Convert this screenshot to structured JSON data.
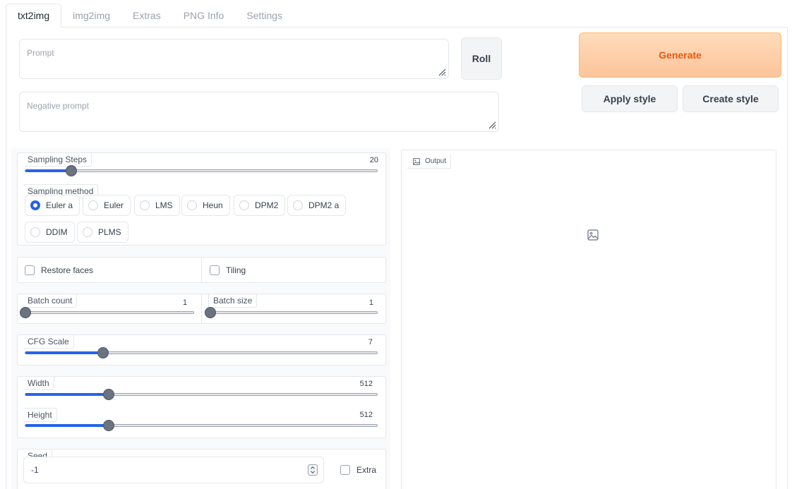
{
  "tabs": [
    {
      "label": "txt2img",
      "active": true
    },
    {
      "label": "img2img",
      "active": false
    },
    {
      "label": "Extras",
      "active": false
    },
    {
      "label": "PNG Info",
      "active": false
    },
    {
      "label": "Settings",
      "active": false
    }
  ],
  "prompt": {
    "placeholder": "Prompt",
    "value": ""
  },
  "negative_prompt": {
    "placeholder": "Negative prompt",
    "value": ""
  },
  "buttons": {
    "roll": "Roll",
    "generate": "Generate",
    "apply_style": "Apply style",
    "create_style": "Create style"
  },
  "sampling_steps": {
    "label": "Sampling Steps",
    "value": "20",
    "min": 1,
    "max": 150,
    "fraction": 0.13
  },
  "sampling_method": {
    "label": "Sampling method",
    "selected": "Euler a",
    "options": [
      "Euler a",
      "Euler",
      "LMS",
      "Heun",
      "DPM2",
      "DPM2 a",
      "DDIM",
      "PLMS"
    ]
  },
  "restore_faces": {
    "label": "Restore faces",
    "checked": false
  },
  "tiling": {
    "label": "Tiling",
    "checked": false
  },
  "batch_count": {
    "label": "Batch count",
    "value": "1",
    "fraction": 0.0
  },
  "batch_size": {
    "label": "Batch size",
    "value": "1",
    "fraction": 0.0
  },
  "cfg_scale": {
    "label": "CFG Scale",
    "value": "7",
    "fraction": 0.22
  },
  "width": {
    "label": "Width",
    "value": "512",
    "fraction": 0.237
  },
  "height": {
    "label": "Height",
    "value": "512",
    "fraction": 0.237
  },
  "seed": {
    "label": "Seed",
    "value": "-1"
  },
  "extra": {
    "label": "Extra",
    "checked": false
  },
  "output": {
    "label": "Output"
  },
  "colors": {
    "accent": "#2563eb",
    "generate_text": "#ea580c",
    "generate_bg": "#fed7aa"
  }
}
